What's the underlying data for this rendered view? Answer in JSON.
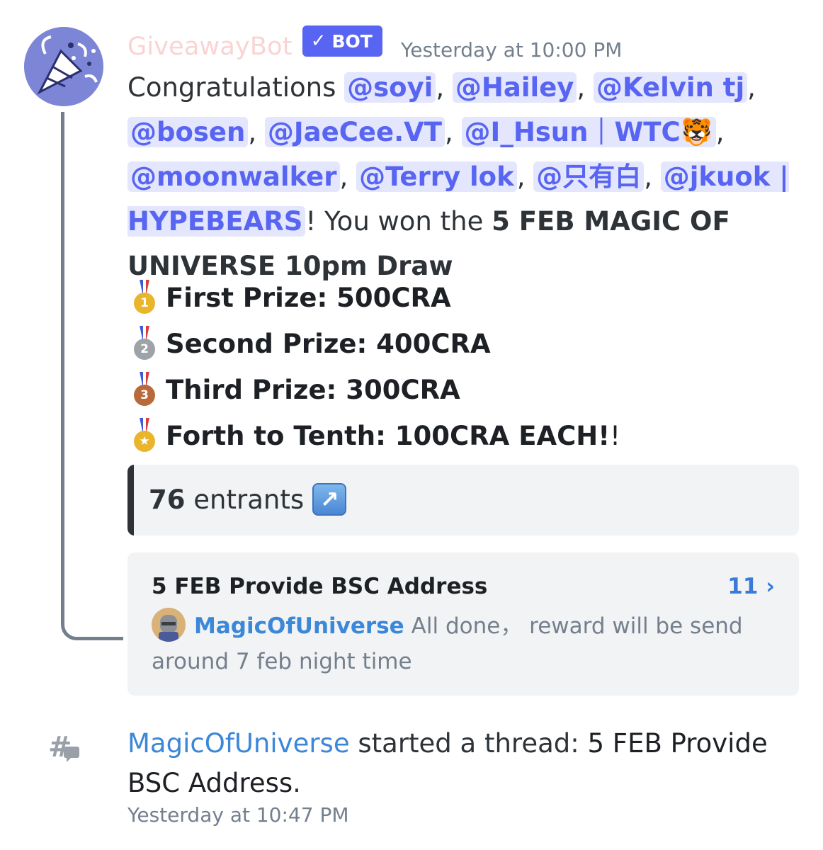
{
  "message": {
    "author": "GiveawayBot",
    "bot_tag": "BOT",
    "timestamp": "Yesterday at 10:00 PM",
    "text_intro": "Congratulations ",
    "mentions": [
      "@soyi",
      "@Hailey",
      "@Kelvin tj",
      "@bosen",
      "@JaeCee.VT",
      "@I_Hsun｜WTC🐯",
      "@moonwalker",
      "@Terry lok",
      "@只有白",
      "@jkuok | HYPEBEARS"
    ],
    "text_after_mentions": "! You won the ",
    "giveaway_name": "5 FEB MAGIC OF UNIVERSE 10pm Draw",
    "prizes": [
      {
        "icon": "first-place-medal-icon",
        "label": "First Prize: 500CRA",
        "medal_color": "#e9b52b",
        "num": "1"
      },
      {
        "icon": "second-place-medal-icon",
        "label": "Second Prize: 400CRA",
        "medal_color": "#9ea3a8",
        "num": "2"
      },
      {
        "icon": "third-place-medal-icon",
        "label": "Third Prize: 300CRA",
        "medal_color": "#b86a3a",
        "num": "3"
      },
      {
        "icon": "sports-medal-icon",
        "label": "Forth to Tenth: 100CRA EACH!",
        "suffix": "!",
        "medal_color": "#e9b52b",
        "num": "★"
      }
    ]
  },
  "embed": {
    "entrants_count": "76",
    "entrants_label": "entrants",
    "link_icon": "up-right-arrow-icon"
  },
  "thread": {
    "title": "5 FEB Provide BSC Address",
    "message_count": "11",
    "preview_author": "MagicOfUniverse",
    "preview_text": "All done， reward will be send around 7 feb night time"
  },
  "system": {
    "user": "MagicOfUniverse",
    "action": " started a thread: ",
    "thread_name": "5 FEB Provide BSC Address",
    "period": ".",
    "timestamp": "Yesterday at 10:47 PM"
  },
  "colors": {
    "blurple": "#5865f2",
    "mention_bg": "#e3e6fc",
    "link_blue": "#3b87d8",
    "muted": "#747f8d"
  }
}
